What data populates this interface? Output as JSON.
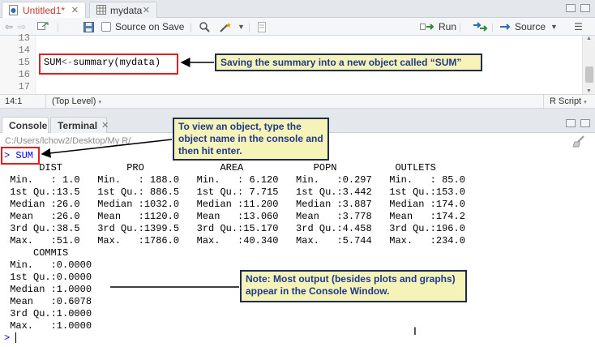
{
  "editor_tabs": [
    {
      "label": "Untitled1*",
      "active": true
    },
    {
      "label": "mydata",
      "active": false
    }
  ],
  "toolbar": {
    "source_on_save": "Source on Save",
    "run": "Run",
    "source": "Source"
  },
  "editor": {
    "lines": [
      {
        "num": "13",
        "code": ""
      },
      {
        "num": "14",
        "code": ""
      },
      {
        "num": "15",
        "code": "SUM<-summary(mydata)"
      },
      {
        "num": "16",
        "code": ""
      },
      {
        "num": "17",
        "code": ""
      }
    ],
    "code_parts": {
      "name": "SUM",
      "op": "<-",
      "rest": "summary(mydata)"
    }
  },
  "status": {
    "position": "14:1",
    "scope": "(Top Level)",
    "filetype": "R Script"
  },
  "console_tabs": [
    {
      "label": "Console",
      "active": true
    },
    {
      "label": "Terminal",
      "active": false
    }
  ],
  "console": {
    "path": "C:/Users/lchow2/Desktop/My R/",
    "prompt": ">",
    "command": "SUM",
    "output_lines": [
      "      DIST           PRO             AREA            POPN          OUTLETS    ",
      " Min.   : 1.0   Min.   : 188.0   Min.   : 6.120   Min.   :0.297   Min.   : 85.0  ",
      " 1st Qu.:13.5   1st Qu.: 886.5   1st Qu.: 7.715   1st Qu.:3.442   1st Qu.:153.0  ",
      " Median :26.0   Median :1032.0   Median :11.200   Median :3.887   Median :174.0  ",
      " Mean   :26.0   Mean   :1120.0   Mean   :13.060   Mean   :3.778   Mean   :174.2  ",
      " 3rd Qu.:38.5   3rd Qu.:1399.5   3rd Qu.:15.170   3rd Qu.:4.458   3rd Qu.:196.0  ",
      " Max.   :51.0   Max.   :1786.0   Max.   :40.340   Max.   :5.744   Max.   :234.0  ",
      "     COMMIS     ",
      " Min.   :0.0000  ",
      " 1st Qu.:0.0000  ",
      " Median :1.0000  ",
      " Mean   :0.6078  ",
      " 3rd Qu.:1.0000  ",
      " Max.   :1.0000  "
    ]
  },
  "annotations": {
    "save_summary": "Saving the summary into a new object called “SUM”",
    "view_object": "To view an object, type the object name in the console and then hit enter.",
    "note_output": "Note: Most output (besides plots and graphs) appear in the Console Window."
  }
}
